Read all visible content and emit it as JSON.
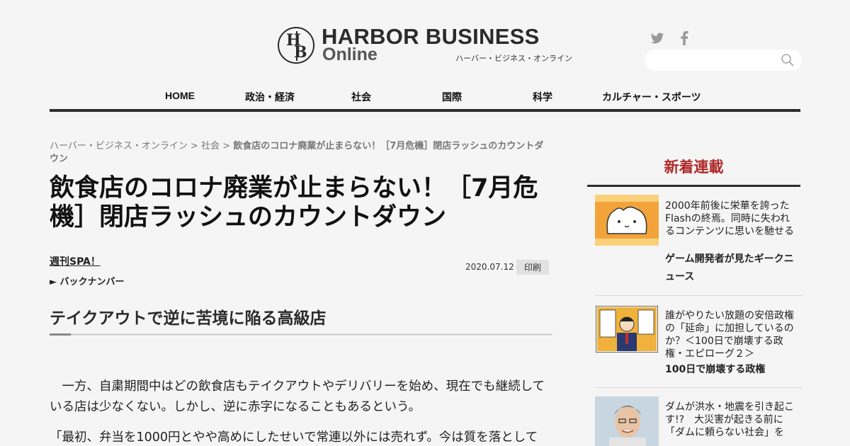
{
  "header": {
    "logo_title": "HARBOR BUSINESS",
    "logo_online": "Online",
    "logo_kana": "ハーバー・ビジネス・オンライン",
    "social": [
      "twitter-icon",
      "facebook-icon"
    ],
    "search": {
      "value": "",
      "icon": "search-icon"
    }
  },
  "nav": {
    "items": [
      {
        "label": "HOME"
      },
      {
        "label": "政治・経済"
      },
      {
        "label": "社会"
      },
      {
        "label": "国際"
      },
      {
        "label": "科学"
      },
      {
        "label": "カルチャー・スポーツ"
      }
    ]
  },
  "breadcrumb": {
    "home": "ハーバー・ビジネス・オンライン",
    "sep": " > ",
    "category": "社会",
    "current": "飲食店のコロナ廃業が止まらない！［7月危機］閉店ラッシュのカウントダウン"
  },
  "article": {
    "headline": "飲食店のコロナ廃業が止まらない！［7月危機］閉店ラッシュのカウントダウン",
    "author": "週刊SPA！",
    "backnumber": "► バックナンバー",
    "date": "2020.07.12",
    "print_label": "印刷",
    "subhead": "テイクアウトで逆に苦境に陥る高級店",
    "paragraphs": [
      "　一方、自粛期間中はどの飲食店もテイクアウトやデリバリーを始め、現在でも継続している店は少なくない。しかし、逆に赤字になることもあるという。",
      "「最初、弁当を1000円とやや高めにしたせいで常連以外には売れず。今は質を落として"
    ]
  },
  "sidebar": {
    "title": "新着連載",
    "items": [
      {
        "desc": "2000年前後に栄華を誇ったFlashの終焉。同時に失われるコンテンツに思いを馳せる",
        "series": "ゲーム開発者が見たギークニュース",
        "thumb_bg": "#f2a43a"
      },
      {
        "desc": "誰がやりたい放題の安倍政権の「延命」に加担しているのか？＜100日で崩壊する政権・エピローグ２＞",
        "series": "100日で崩壊する政権",
        "thumb_bg": "#f0b23c"
      },
      {
        "desc": "ダムが洪水・地震を引き起こす!?　大災害が起きる前に「ダムに頼らない社会」を",
        "series": "",
        "thumb_bg": "#9fb6c8"
      }
    ]
  }
}
